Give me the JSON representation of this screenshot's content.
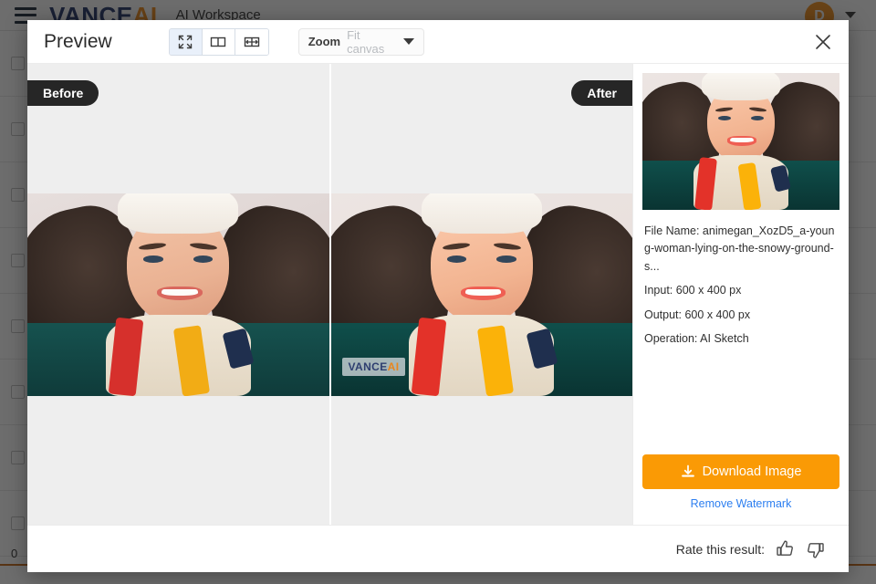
{
  "background": {
    "logo_vance": "VANCE",
    "logo_ai": "AI",
    "workspace_title": "AI Workspace",
    "avatar_initial": "D",
    "count_label": "0",
    "hamburger_icon": "hamburger-menu-icon",
    "bottom_text": ""
  },
  "modal": {
    "title": "Preview",
    "close_icon": "close-icon",
    "view_modes": [
      {
        "id": "fit-screen",
        "icon": "expand-icon",
        "active": true
      },
      {
        "id": "side-by-side",
        "icon": "split-view-icon",
        "active": false
      },
      {
        "id": "slider-compare",
        "icon": "compare-slider-icon",
        "active": false
      }
    ],
    "zoom": {
      "label": "Zoom",
      "value": "Fit canvas",
      "placeholder": "Fit canvas",
      "caret_icon": "chevron-down-icon"
    },
    "panes": {
      "before_badge": "Before",
      "after_badge": "After",
      "watermark_vance": "VANCE",
      "watermark_ai": "AI"
    },
    "info": {
      "thumbnail_alt": "result-thumbnail",
      "file_name_key": "File Name:",
      "file_name_value": "animegan_XozD5_a-young-woman-lying-on-the-snowy-ground-s...",
      "input_key": "Input:",
      "input_value": "600 x 400 px",
      "output_key": "Output:",
      "output_value": "600 x 400 px",
      "operation_key": "Operation:",
      "operation_value": "AI Sketch",
      "download_label": "Download Image",
      "download_icon": "download-icon",
      "remove_watermark_label": "Remove Watermark"
    },
    "footer": {
      "rate_label": "Rate this result:",
      "thumbs_up_icon": "thumbs-up-icon",
      "thumbs_down_icon": "thumbs-down-icon"
    }
  },
  "colors": {
    "accent_orange": "#fa9a05",
    "link_blue": "#2d7ff0",
    "brand_navy": "#24356b",
    "badge_dark": "#262626",
    "canvas_gray": "#eeeeee"
  }
}
